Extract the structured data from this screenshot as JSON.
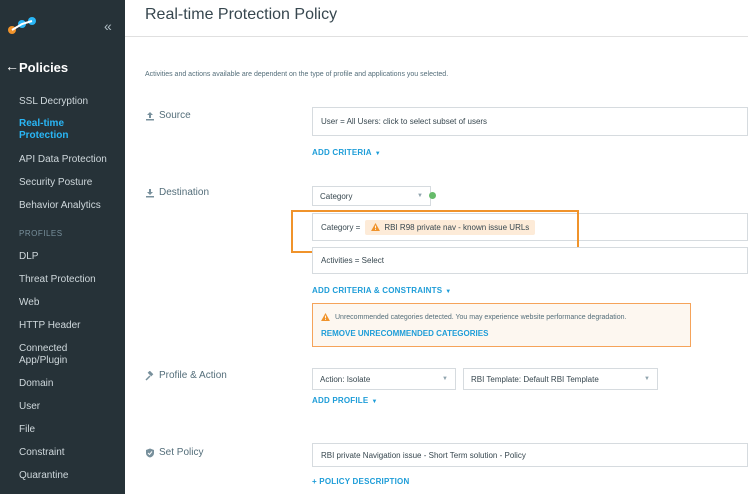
{
  "sidebar": {
    "collapse_icon": "double-chevron-left-icon",
    "back_icon": "arrow-left-icon",
    "section_title": "Policies",
    "items": [
      {
        "label": "SSL Decryption"
      },
      {
        "label": "Real-time Protection",
        "active": true
      },
      {
        "label": "API Data Protection"
      },
      {
        "label": "Security Posture"
      },
      {
        "label": "Behavior Analytics"
      }
    ],
    "profiles_header": "PROFILES",
    "profiles": [
      {
        "label": "DLP"
      },
      {
        "label": "Threat Protection"
      },
      {
        "label": "Web"
      },
      {
        "label": "HTTP Header"
      },
      {
        "label": "Connected App/Plugin"
      },
      {
        "label": "Domain"
      },
      {
        "label": "User"
      },
      {
        "label": "File"
      },
      {
        "label": "Constraint"
      },
      {
        "label": "Quarantine"
      }
    ]
  },
  "main": {
    "title": "Real-time Protection Policy",
    "intro": "Activities and actions available are dependent on the type of profile and applications you selected.",
    "source": {
      "label": "Source",
      "user_field": "User = All Users: click to select subset of users",
      "add_criteria": "ADD CRITERIA"
    },
    "destination": {
      "label": "Destination",
      "category_select": "Category",
      "category_prefix": "Category =",
      "category_chip": "RBI R98 private nav - known issue URLs",
      "activities_field": "Activities = Select",
      "add_criteria": "ADD CRITERIA & CONSTRAINTS",
      "warning": "Unrecommended categories detected. You may experience website performance degradation.",
      "remove_link": "REMOVE UNRECOMMENDED CATEGORIES"
    },
    "profile_action": {
      "label": "Profile & Action",
      "action_label": "Action:",
      "action_value": "Isolate",
      "template_label": "RBI Template:",
      "template_value": "Default RBI Template",
      "add_profile": "ADD PROFILE"
    },
    "set_policy": {
      "label": "Set Policy",
      "policy_name": "RBI private Navigation issue - Short Term solution - Policy",
      "add_description": "+ POLICY DESCRIPTION"
    }
  },
  "colors": {
    "sidebar_bg": "#263238",
    "accent": "#1e9dd8",
    "active_nav": "#29b6f6",
    "warning": "#f0932b",
    "status_green": "#66bb6a"
  }
}
